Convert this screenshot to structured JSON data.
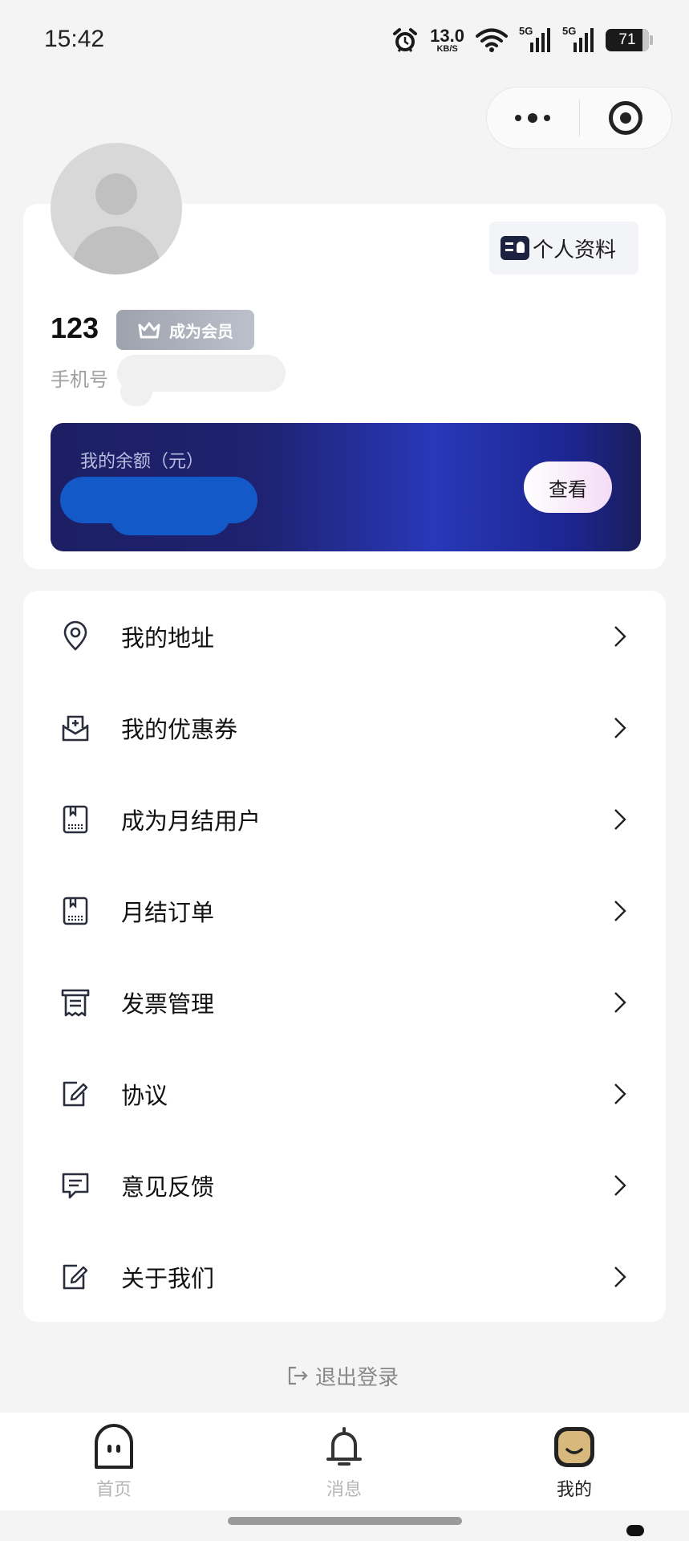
{
  "status_bar": {
    "time": "15:42",
    "net_speed": "13.0",
    "net_unit": "KB/S",
    "sim1": "5G",
    "sim2": "5G",
    "battery": "71",
    "icons": [
      "alarm-icon",
      "wifi-icon",
      "signal-icon",
      "battery-icon"
    ]
  },
  "capsule": {
    "more_icon": "more-dots-icon",
    "close_icon": "target-circle-icon"
  },
  "profile": {
    "edit_label": "个人资料",
    "username": "123",
    "vip_label": "成为会员",
    "phone_label": "手机号"
  },
  "balance": {
    "title": "我的余额（元）",
    "view_label": "查看"
  },
  "menu": [
    {
      "label": "我的地址",
      "icon": "location-pin-icon"
    },
    {
      "label": "我的优惠券",
      "icon": "coupon-inbox-icon"
    },
    {
      "label": "成为月结用户",
      "icon": "ledger-icon"
    },
    {
      "label": "月结订单",
      "icon": "ledger-icon"
    },
    {
      "label": "发票管理",
      "icon": "invoice-icon"
    },
    {
      "label": "协议",
      "icon": "edit-document-icon"
    },
    {
      "label": "意见反馈",
      "icon": "message-icon"
    },
    {
      "label": "关于我们",
      "icon": "edit-document-icon"
    }
  ],
  "logout_label": "退出登录",
  "tabbar": [
    {
      "label": "首页",
      "icon": "home-face-icon",
      "active": false
    },
    {
      "label": "消息",
      "icon": "bell-icon",
      "active": false
    },
    {
      "label": "我的",
      "icon": "mine-face-icon",
      "active": true
    }
  ],
  "colors": {
    "background": "#f4f4f5",
    "balance_card": "#1e2270",
    "balance_accent": "#2838b8",
    "vip_badge": "#a8acb6",
    "inactive_tab": "#b5b5b5"
  }
}
